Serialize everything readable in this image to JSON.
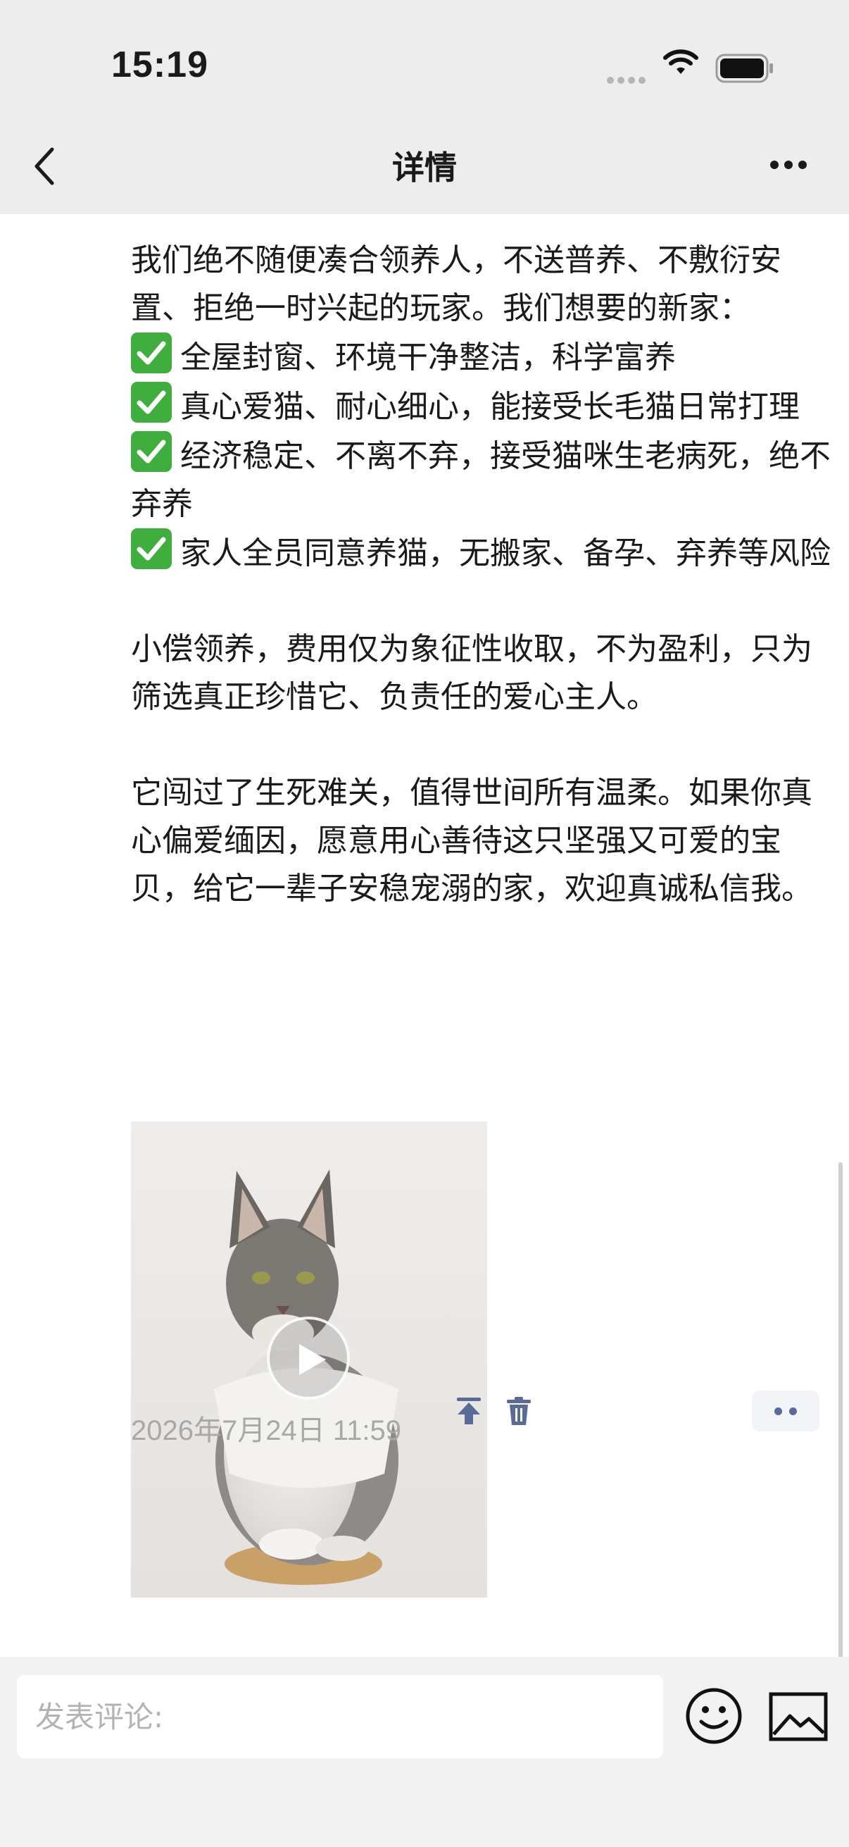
{
  "status_bar": {
    "time": "15:19"
  },
  "nav": {
    "title": "详情"
  },
  "post": {
    "paragraphs": [
      "我们绝不随便凑合领养人，不送普养、不敷衍安置、拒绝一时兴起的玩家。我们想要的新家：",
      "小偿领养，费用仅为象征性收取，不为盈利，只为筛选真正珍惜它、负责任的爱心主人。",
      "它闯过了生死难关，值得世间所有温柔。如果你真心偏爱缅因，愿意用心善待这只坚强又可爱的宝贝，给它一辈子安稳宠溺的家，欢迎真诚私信我。"
    ],
    "requirements": [
      "全屋封窗、环境干净整洁，科学富养",
      "真心爱猫、耐心细心，能接受长毛猫日常打理",
      "经济稳定、不离不弃，接受猫咪生老病死，绝不弃养",
      "家人全员同意养猫，无搬家、备孕、弃养等风险"
    ],
    "timestamp": "2026年7月24日 11:59"
  },
  "comment": {
    "placeholder": "发表评论:"
  },
  "icons": {
    "back": "chevron-left-icon",
    "more": "more-dots-icon",
    "check": "check-mark-icon",
    "play": "play-icon",
    "pin": "pin-to-top-icon",
    "delete": "trash-icon",
    "emoji": "smiley-icon",
    "image": "image-icon"
  },
  "colors": {
    "accent": "#5b6b99",
    "check": "#3fae3f",
    "background": "#ededed"
  }
}
